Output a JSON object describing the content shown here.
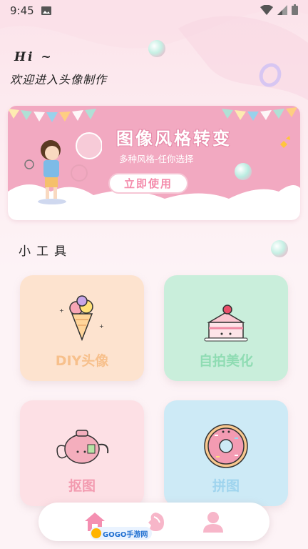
{
  "status_bar": {
    "time": "9:45"
  },
  "greeting": {
    "hi": "Hi ~",
    "welcome": "欢迎进入头像制作"
  },
  "banner": {
    "title": "图像风格转变",
    "subtitle": "多种风格-任你选择",
    "button_label": "立即使用"
  },
  "tools_section": {
    "title": "小工具"
  },
  "tools": [
    {
      "label": "DIY头像",
      "bg": "#fde3cf",
      "icon": "ice-cream-icon"
    },
    {
      "label": "自拍美化",
      "bg": "#c9eedb",
      "icon": "cake-icon"
    },
    {
      "label": "抠图",
      "bg": "#fde0e5",
      "icon": "teapot-icon"
    },
    {
      "label": "拼图",
      "bg": "#cdeaf6",
      "icon": "donut-icon"
    }
  ],
  "tabbar": {
    "items": [
      "home-icon",
      "profile-face-icon",
      "user-icon"
    ],
    "active_color": "#f48fb1",
    "watermark": "GOGO手游网"
  },
  "colors": {
    "accent": "#f48fb1",
    "banner": "#f2a9c1"
  }
}
